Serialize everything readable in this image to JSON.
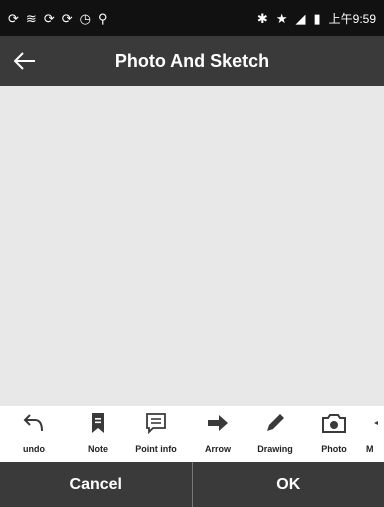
{
  "status_bar": {
    "time": "上午9:59",
    "icons": [
      "sync-icon",
      "wifi-icon",
      "sync-icon",
      "sync-icon",
      "clock-icon",
      "location-icon",
      "bluetooth-icon",
      "star-icon",
      "signal-icon",
      "battery-icon"
    ]
  },
  "app_bar": {
    "title": "Photo And Sketch"
  },
  "toolbar": {
    "undo_label": "undo",
    "note_label": "Note",
    "point_info_label": "Point info",
    "arrow_label": "Arrow",
    "drawing_label": "Drawing",
    "photo_label": "Photo",
    "more_label": "M"
  },
  "bottom": {
    "cancel_label": "Cancel",
    "ok_label": "OK"
  },
  "colors": {
    "status_bar": "#111111",
    "app_bar": "#3a3a3a",
    "canvas": "#e8e8e8",
    "toolbar": "#ffffff",
    "icon": "#3a3a3a"
  }
}
